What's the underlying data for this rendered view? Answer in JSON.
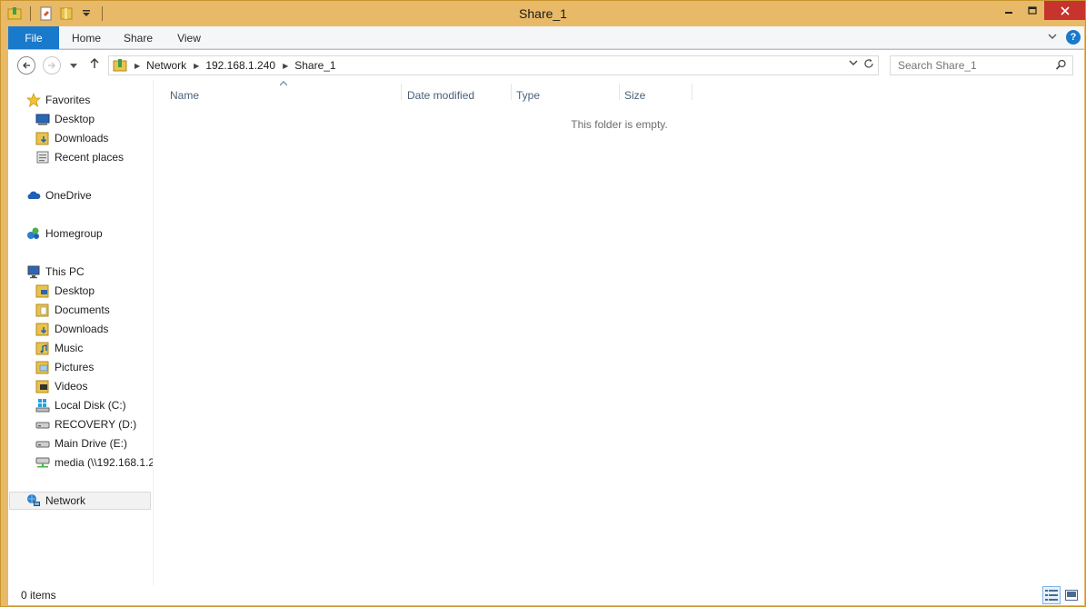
{
  "window": {
    "title": "Share_1"
  },
  "ribbon": {
    "tabs": [
      "File",
      "Home",
      "Share",
      "View"
    ]
  },
  "address": {
    "crumbs": [
      "Network",
      "192.168.1.240",
      "Share_1"
    ],
    "search_placeholder": "Search Share_1"
  },
  "nav": {
    "favorites": {
      "label": "Favorites",
      "items": [
        "Desktop",
        "Downloads",
        "Recent places"
      ]
    },
    "onedrive": "OneDrive",
    "homegroup": "Homegroup",
    "thispc": {
      "label": "This PC",
      "items": [
        "Desktop",
        "Documents",
        "Downloads",
        "Music",
        "Pictures",
        "Videos",
        "Local Disk (C:)",
        "RECOVERY (D:)",
        "Main Drive (E:)",
        "media (\\\\192.168.1.2"
      ]
    },
    "network": "Network"
  },
  "columns": [
    "Name",
    "Date modified",
    "Type",
    "Size"
  ],
  "empty_message": "This folder is empty.",
  "status": {
    "items": "0 items"
  },
  "colors": {
    "frame": "#e8b966",
    "accent": "#1979ca",
    "close": "#c7342d"
  }
}
